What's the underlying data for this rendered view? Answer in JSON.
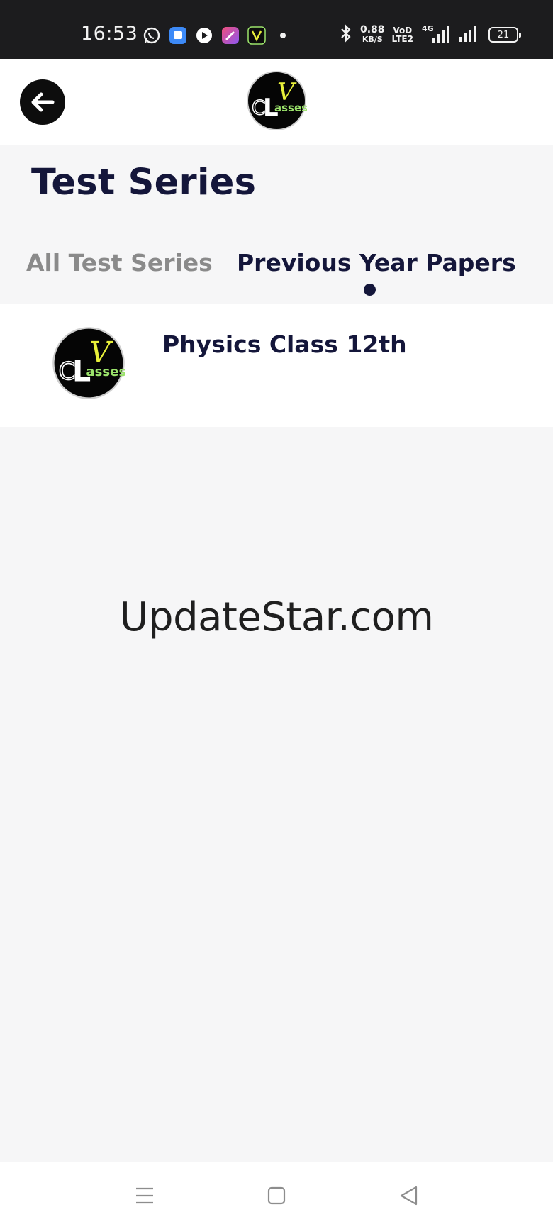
{
  "status_bar": {
    "time": "16:53",
    "net_speed_value": "0.88",
    "net_speed_unit": "KB/S",
    "volte_top": "VoD",
    "volte_bottom": "LTE2",
    "network_type": "4G",
    "battery_level": "21",
    "notification_icons": [
      "whatsapp-icon",
      "chat-app-icon",
      "youtube-icon",
      "app-icon",
      "classes-app-icon",
      "dot-icon"
    ]
  },
  "header": {
    "logo_letters": {
      "top": "V",
      "left": "C",
      "middle": "L",
      "rest": "asses"
    }
  },
  "page": {
    "title": "Test Series"
  },
  "tabs": [
    {
      "label": "All Test Series",
      "active": false
    },
    {
      "label": "Previous Year Papers",
      "active": true
    }
  ],
  "list": {
    "items": [
      {
        "title": "Physics Class 12th"
      }
    ]
  },
  "watermark": "UpdateStar.com",
  "colors": {
    "primary": "#14163a",
    "inactive_tab": "#8a8a8a",
    "logo_yellow": "#e8f03a",
    "logo_green": "#9be36b"
  }
}
